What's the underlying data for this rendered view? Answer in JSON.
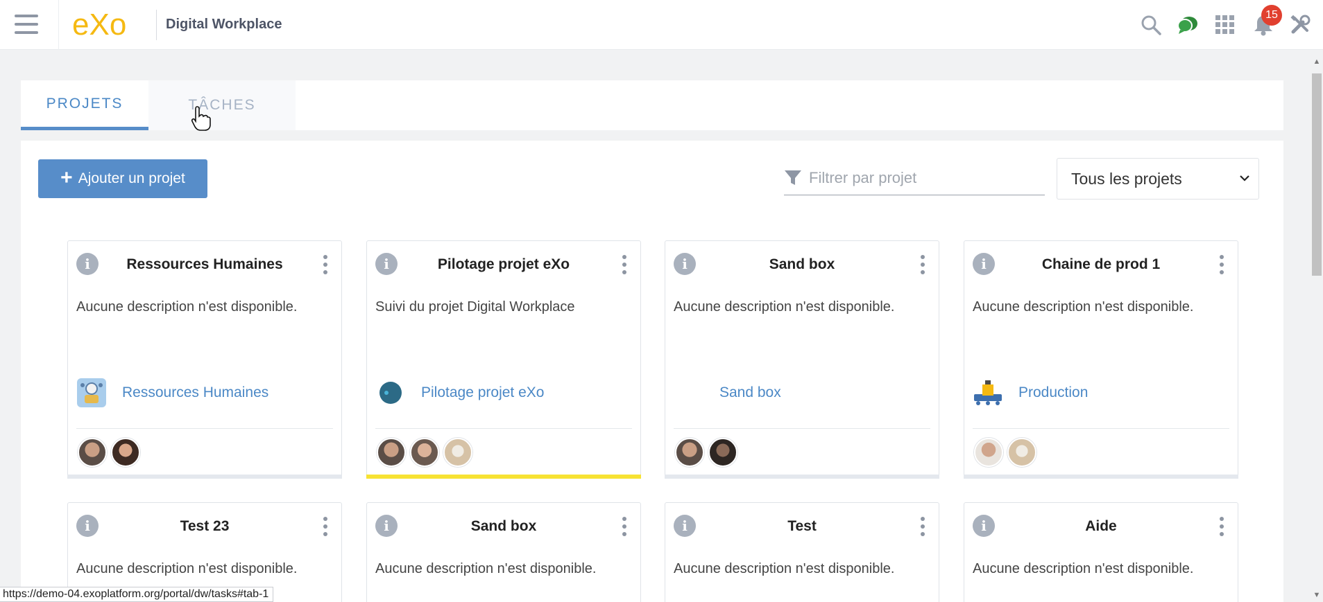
{
  "header": {
    "brand_logo": "eXo",
    "title": "Digital Workplace",
    "notifications_count": "15",
    "icons": [
      "menu-icon",
      "search-icon",
      "chat-icon",
      "apps-grid-icon",
      "bell-icon",
      "admin-tools-icon"
    ]
  },
  "tabs": [
    {
      "label": "PROJETS",
      "active": true
    },
    {
      "label": "TÂCHES",
      "active": false
    }
  ],
  "toolbar": {
    "add_label": "Ajouter un projet",
    "filter_placeholder": "Filtrer par projet",
    "select_value": "Tous les projets"
  },
  "cards": [
    {
      "title": "Ressources Humaines",
      "description": "Aucune description n'est disponible.",
      "space": "Ressources Humaines",
      "members": 2,
      "accent": ""
    },
    {
      "title": "Pilotage projet eXo",
      "description": "Suivi du projet Digital Workplace",
      "space": "Pilotage projet eXo",
      "members": 3,
      "accent": "#f7e233"
    },
    {
      "title": "Sand box",
      "description": "Aucune description n'est disponible.",
      "space": "Sand box",
      "members": 2,
      "accent": ""
    },
    {
      "title": "Chaine de prod 1",
      "description": "Aucune description n'est disponible.",
      "space": "Production",
      "members": 2,
      "accent": ""
    },
    {
      "title": "Test 23",
      "description": "Aucune description n'est disponible."
    },
    {
      "title": "Sand box",
      "description": "Aucune description n'est disponible."
    },
    {
      "title": "Test",
      "description": "Aucune description n'est disponible."
    },
    {
      "title": "Aide",
      "description": "Aucune description n'est disponible."
    }
  ],
  "status_url": "https://demo-04.exoplatform.org/portal/dw/tasks#tab-1",
  "colors": {
    "accent_blue": "#578dc9",
    "link_blue": "#4b88c6",
    "badge_red": "#e1402f",
    "logo_yellow": "#f5b912",
    "chat_green": "#2e8a3a"
  }
}
